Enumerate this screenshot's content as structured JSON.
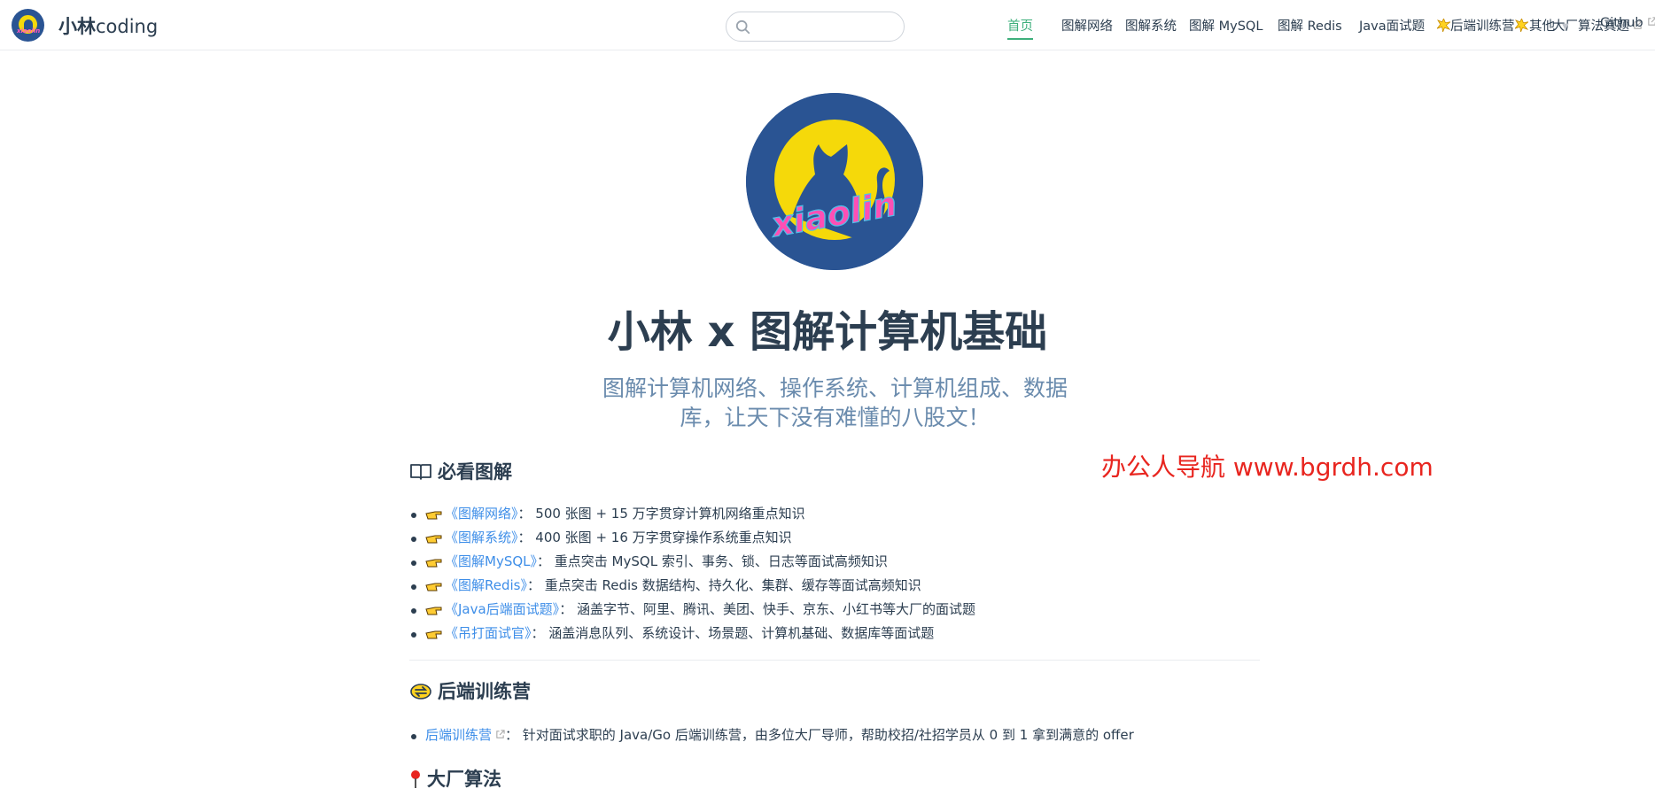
{
  "header": {
    "site_name_bold": "小林",
    "site_name_rest": "coding",
    "search_placeholder": "",
    "nav": [
      {
        "label": "首页"
      },
      {
        "label": "图解网络"
      },
      {
        "label": "图解系统"
      },
      {
        "label": "图解 MySQL"
      },
      {
        "label": "图解 Redis"
      },
      {
        "label": "Java面试题"
      },
      {
        "label": "后端训练营"
      },
      {
        "label": "大厂算法真题"
      },
      {
        "label": "其他"
      },
      {
        "label": "Github"
      }
    ]
  },
  "hero": {
    "logo_text": "xiaolin",
    "title": "小林 x 图解计算机基础",
    "description": "图解计算机网络、操作系统、计算机组成、数据库，让天下没有难懂的八股文！"
  },
  "watermark": "办公人导航 www.bgrdh.com",
  "sections": {
    "must_read": {
      "title": "必看图解",
      "items": [
        {
          "link": "《图解网络》",
          "text": "： 500 张图 + 15 万字贯穿计算机网络重点知识"
        },
        {
          "link": "《图解系统》",
          "text": "： 400 张图 + 16 万字贯穿操作系统重点知识"
        },
        {
          "link": "《图解MySQL》",
          "text": "： 重点突击 MySQL 索引、事务、锁、日志等面试高频知识"
        },
        {
          "link": "《图解Redis》",
          "text": "： 重点突击 Redis 数据结构、持久化、集群、缓存等面试高频知识"
        },
        {
          "link": "《Java后端面试题》",
          "text": "： 涵盖字节、阿里、腾讯、美团、快手、京东、小红书等大厂的面试题"
        },
        {
          "link": "《吊打面试官》",
          "text": "： 涵盖消息队列、系统设计、场景题、计算机基础、数据库等面试题"
        }
      ]
    },
    "bootcamp": {
      "title": "后端训练营",
      "items": [
        {
          "link": "后端训练营",
          "text": "： 针对面试求职的 Java/Go 后端训练营，由多位大厂导师，帮助校招/社招学员从 0 到 1 拿到满意的 offer"
        }
      ]
    },
    "algo": {
      "title": "大厂算法"
    }
  },
  "colors": {
    "accent": "#3eaf7c",
    "link_blue": "#3e8ee8",
    "text": "#2c3e50",
    "desc": "#6a8bad",
    "logo_bg": "#2a5493",
    "logo_moon": "#f5d90a",
    "watermark": "#e8251f"
  },
  "icons": [
    "search-icon",
    "book-icon",
    "pointing-hand-icon",
    "external-link-icon",
    "burst-icon",
    "swap-icon",
    "pin-icon",
    "chevron-down-icon"
  ]
}
